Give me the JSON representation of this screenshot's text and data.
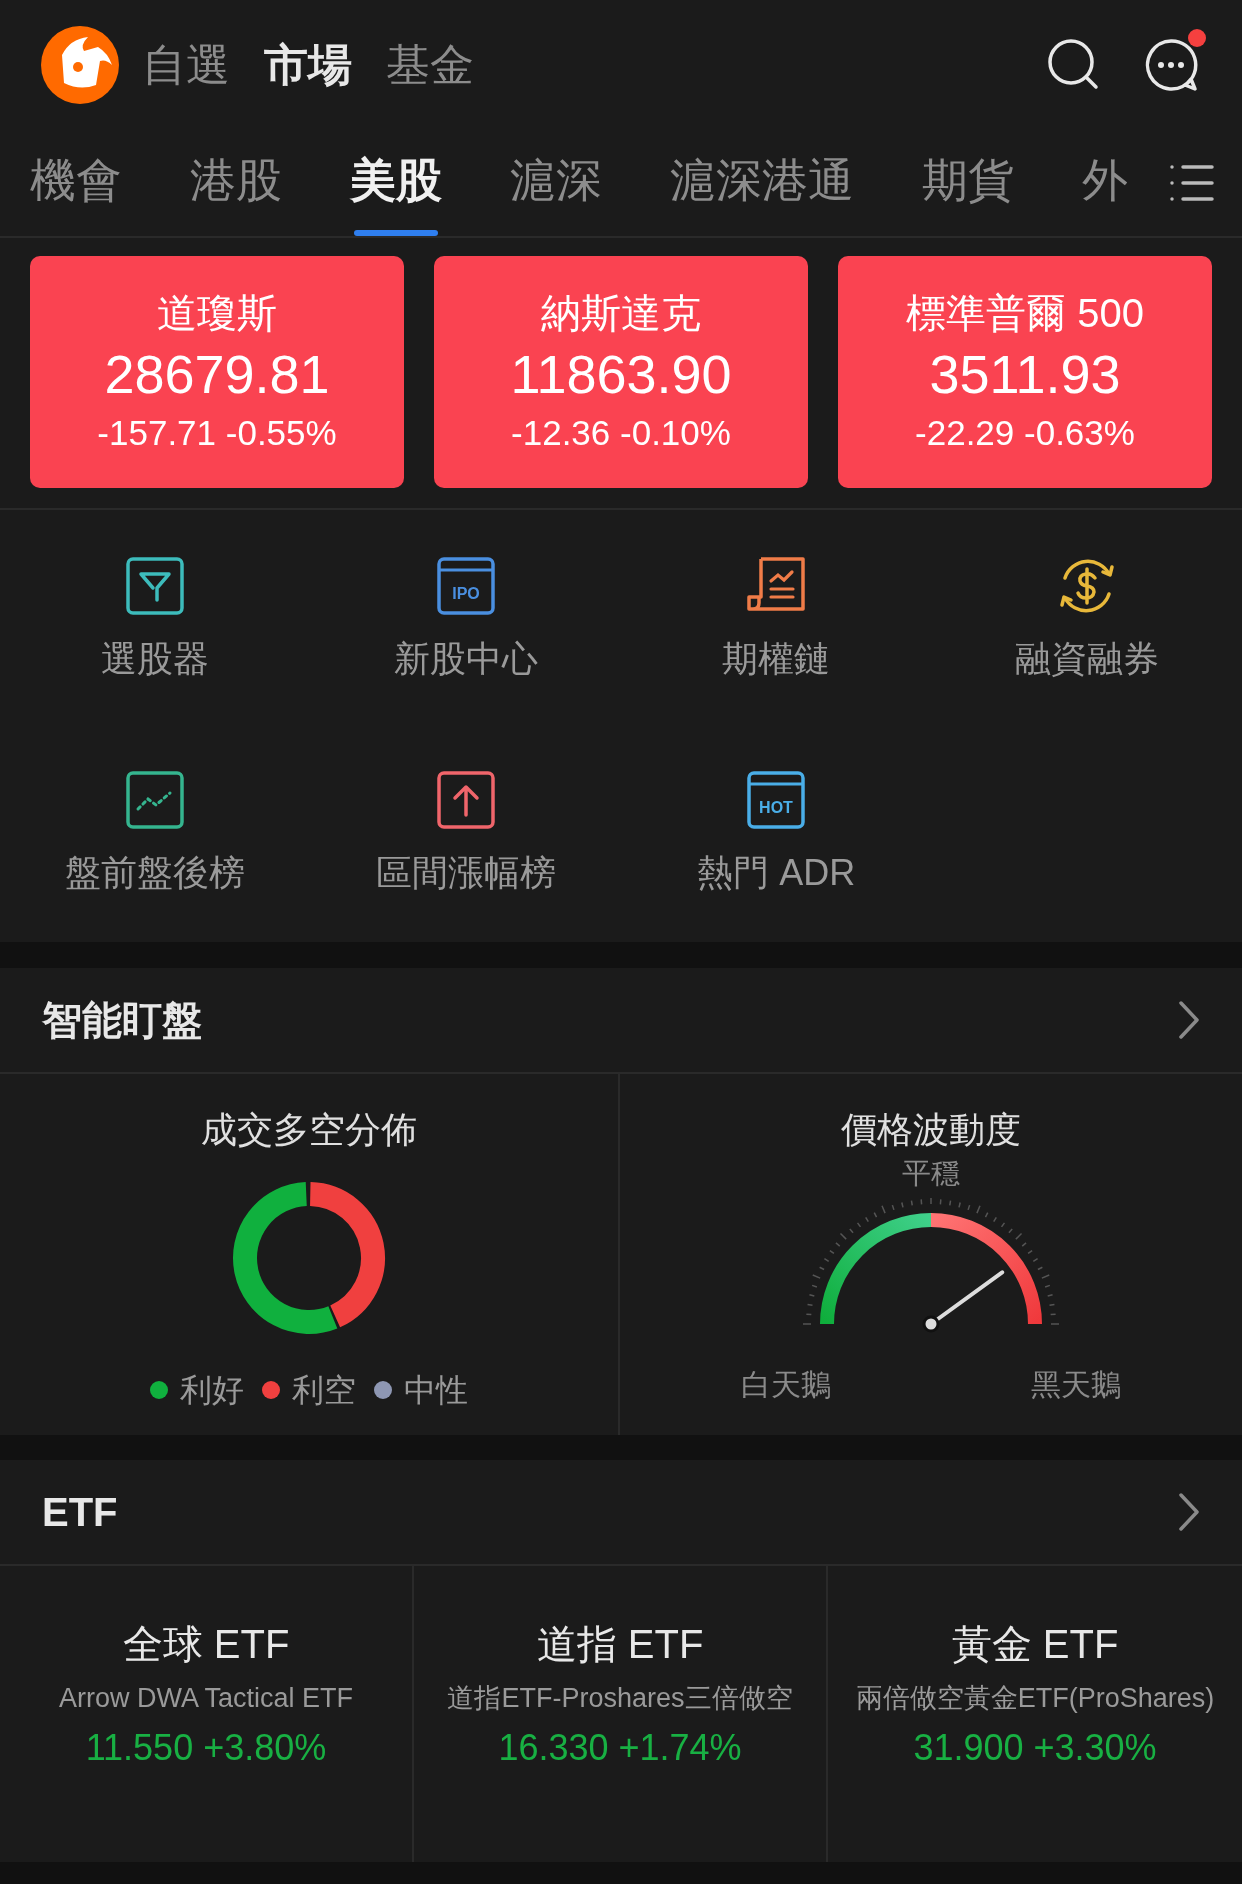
{
  "top_nav": [
    {
      "label": "自選",
      "selected": false
    },
    {
      "label": "市場",
      "selected": true
    },
    {
      "label": "基金",
      "selected": false
    }
  ],
  "messages": {
    "has_badge": true
  },
  "market_tabs": [
    {
      "label": "機會",
      "selected": false
    },
    {
      "label": "港股",
      "selected": false
    },
    {
      "label": "美股",
      "selected": true
    },
    {
      "label": "滬深",
      "selected": false
    },
    {
      "label": "滬深港通",
      "selected": false
    },
    {
      "label": "期貨",
      "selected": false
    },
    {
      "label": "外",
      "selected": false
    }
  ],
  "indices": [
    {
      "name": "道瓊斯",
      "value": "28679.81",
      "change": "-157.71 -0.55%"
    },
    {
      "name": "納斯達克",
      "value": "11863.90",
      "change": "-12.36 -0.10%"
    },
    {
      "name": "標準普爾 500",
      "value": "3511.93",
      "change": "-22.29 -0.63%"
    }
  ],
  "tools": [
    {
      "label": "選股器"
    },
    {
      "label": "新股中心",
      "icon_text": "IPO"
    },
    {
      "label": "期權鏈"
    },
    {
      "label": "融資融券"
    },
    {
      "label": "盤前盤後榜"
    },
    {
      "label": "區間漲幅榜"
    },
    {
      "label": "熱門 ADR",
      "icon_text": "HOT"
    }
  ],
  "smart_watch": {
    "title": "智能盯盤",
    "distribution": {
      "title": "成交多空分佈",
      "legend": [
        {
          "label": "利好",
          "color": "#10b03e"
        },
        {
          "label": "利空",
          "color": "#f0403f"
        },
        {
          "label": "中性",
          "color": "#8e97b3"
        }
      ]
    },
    "volatility": {
      "title": "價格波動度",
      "reading": "平穩",
      "left_label": "白天鵝",
      "right_label": "黑天鵝"
    }
  },
  "etf": {
    "title": "ETF",
    "items": [
      {
        "category": "全球 ETF",
        "name": "Arrow DWA Tactical ETF",
        "quote": "11.550 +3.80%"
      },
      {
        "category": "道指 ETF",
        "name": "道指ETF-Proshares三倍做空",
        "quote": "16.330 +1.74%"
      },
      {
        "category": "黃金 ETF",
        "name": "兩倍做空黃金ETF(ProShares)",
        "quote": "31.900 +3.30%"
      }
    ]
  }
}
